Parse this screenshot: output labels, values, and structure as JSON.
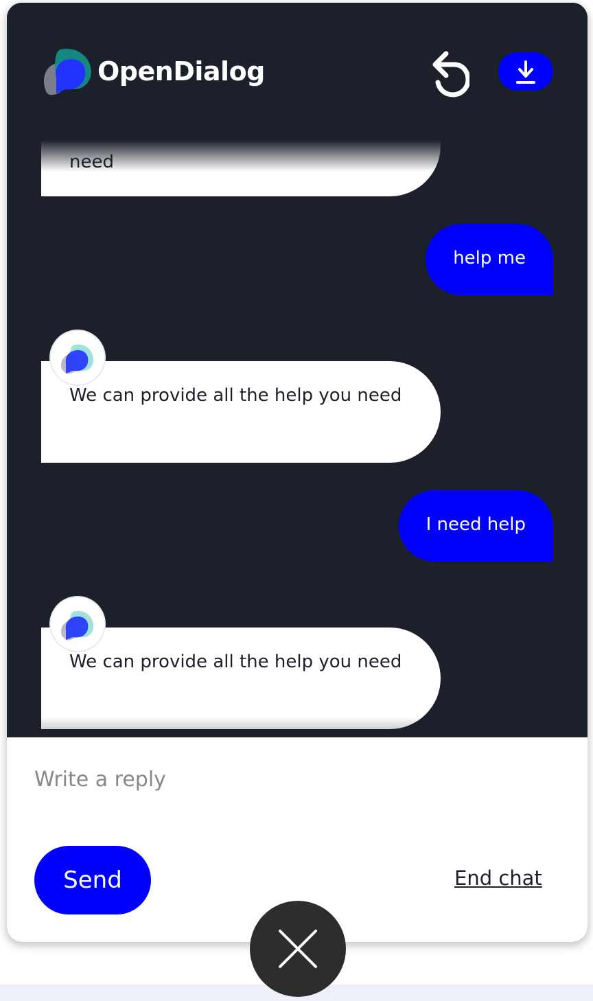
{
  "header": {
    "brand": "OpenDialog",
    "restart_icon": "restart-icon",
    "download_icon": "download-icon"
  },
  "messages": [
    {
      "sender": "bot",
      "text": "need",
      "partially_scrolled": true
    },
    {
      "sender": "user",
      "text": "help me"
    },
    {
      "sender": "bot",
      "text": "We can provide all the help you need"
    },
    {
      "sender": "user",
      "text": "I need help"
    },
    {
      "sender": "bot",
      "text": "We can provide all the help you need"
    }
  ],
  "composer": {
    "reply_value": "",
    "reply_placeholder": "Write a reply",
    "send_label": "Send",
    "end_chat_label": "End chat"
  },
  "launcher": {
    "close_icon": "close-icon"
  },
  "colors": {
    "accent": "#0000ff",
    "chat_background": "#1c202b",
    "bot_bubble": "#ffffff",
    "close_button": "#2d2d2d"
  }
}
